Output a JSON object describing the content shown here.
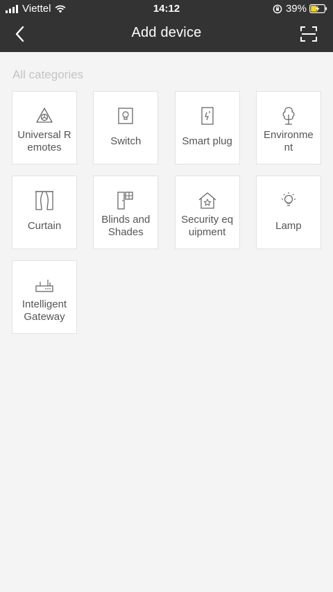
{
  "status_bar": {
    "carrier": "Viettel",
    "time": "14:12",
    "battery": "39%"
  },
  "header": {
    "title": "Add device"
  },
  "section": {
    "title": "All categories"
  },
  "categories": [
    {
      "label": "Universal Remotes",
      "icon": "universal-remote-icon"
    },
    {
      "label": "Switch",
      "icon": "switch-icon"
    },
    {
      "label": "Smart plug",
      "icon": "smart-plug-icon"
    },
    {
      "label": "Environme nt",
      "icon": "environment-tree-icon"
    },
    {
      "label": "Curtain",
      "icon": "curtain-icon"
    },
    {
      "label": "Blinds and Shades",
      "icon": "blinds-icon"
    },
    {
      "label": "Security equipment",
      "icon": "security-house-icon"
    },
    {
      "label": "Lamp",
      "icon": "lamp-icon"
    },
    {
      "label": "Intelligent Gateway",
      "icon": "gateway-router-icon"
    }
  ],
  "colors": {
    "header_bg": "#333333",
    "page_bg": "#f4f4f4",
    "tile_bg": "#ffffff",
    "icon_stroke": "#666666",
    "battery_charging": "#f5d90a"
  }
}
